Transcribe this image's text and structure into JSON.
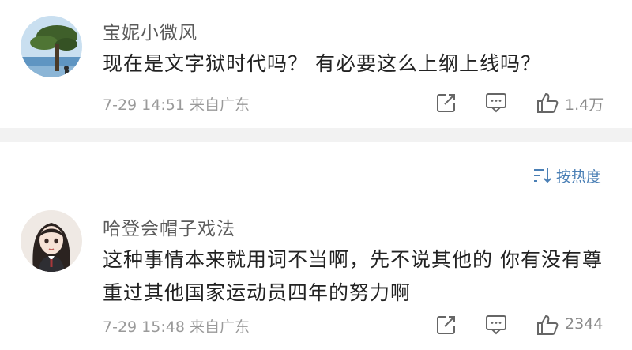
{
  "comments": [
    {
      "username": "宝妮小微风",
      "text": "现在是文字狱时代吗？ 有必要这么上纲上线吗？",
      "timestamp": "7-29 14:51",
      "location": "来自广东",
      "like_count": "1.4万"
    },
    {
      "username": "哈登会帽子戏法",
      "text": "这种事情本来就用词不当啊，先不说其他的 你有没有尊重过其他国家运动员四年的努力啊",
      "timestamp": "7-29 15:48",
      "location": "来自广东",
      "like_count": "2344"
    }
  ],
  "sort": {
    "label": "按热度",
    "icon": "sort-icon"
  },
  "colors": {
    "accent": "#4a7fb5",
    "meta": "#9a9a9a",
    "divider": "#f2f2f2"
  }
}
